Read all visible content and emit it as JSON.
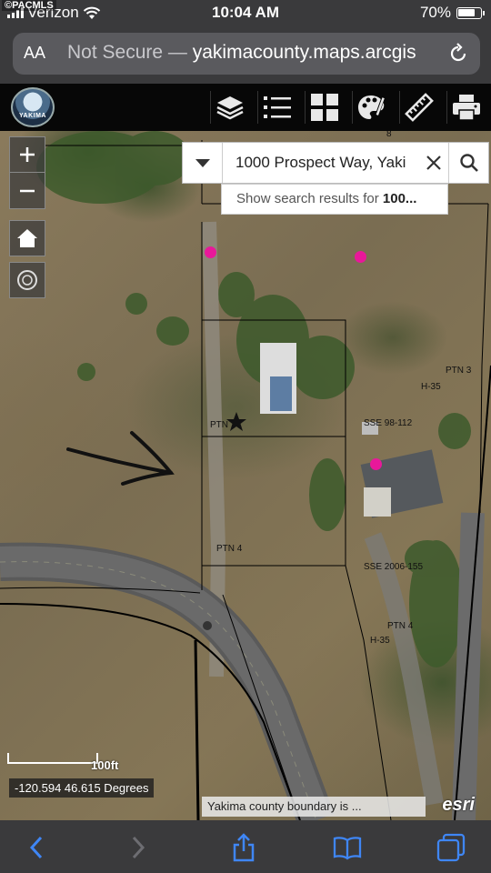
{
  "status_bar": {
    "watermark": "©PACMLS",
    "carrier": "Verizon",
    "time": "10:04 AM",
    "battery": "70%"
  },
  "browser": {
    "reader_label": "AA",
    "address": "Not Secure — yakimacounty.maps.arcgis",
    "address_prefix": "Not Secure — ",
    "address_host": "yakimacounty.maps.arcgis"
  },
  "app_header": {
    "logo_text": "YAKIMA",
    "tools": [
      "layers-icon",
      "legend-list-icon",
      "basemap-gallery-icon",
      "palette-icon",
      "ruler-icon",
      "print-icon"
    ]
  },
  "search": {
    "value": "1000 Prospect Way, Yaki",
    "suggestion_prefix": "Show search results for ",
    "suggestion_term": "100..."
  },
  "map": {
    "labels": {
      "parcel_8": "8",
      "ptn3": "PTN 3",
      "h35_a": "H-35",
      "ptn_star": "PTN",
      "sse98": "SSE 98-112",
      "ptn4_a": "PTN 4",
      "sse2006": "SSE 2006-155",
      "ptn4_b": "PTN 4",
      "h35_b": "H-35"
    },
    "scale_label": "100ft",
    "coordinates": "-120.594 46.615 Degrees",
    "attribution": "Yakima county boundary is ...",
    "esri_logo": "esri",
    "marker_color": "#e8189a"
  }
}
